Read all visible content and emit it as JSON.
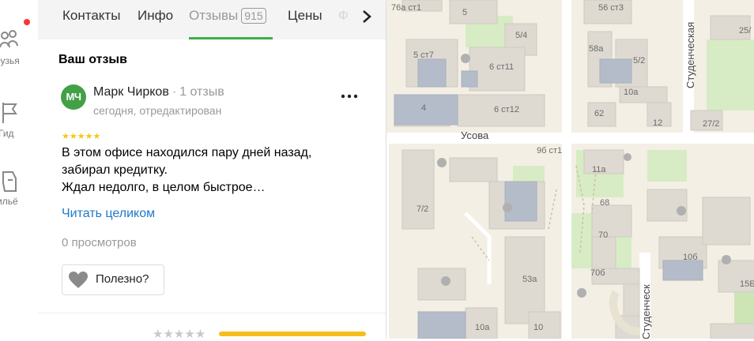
{
  "sidebar": {
    "items": [
      {
        "label": "рузья",
        "icon": "friends-icon"
      },
      {
        "label": "Гид",
        "icon": "flag-icon"
      },
      {
        "label": "ильё",
        "icon": "hand-icon"
      }
    ],
    "notification_color": "#ff3333"
  },
  "tabs": [
    {
      "label": "Контакты"
    },
    {
      "label": "Инфо"
    },
    {
      "label": "Отзывы",
      "badge": "915",
      "active": true
    },
    {
      "label": "Цены"
    },
    {
      "label": "Ф"
    }
  ],
  "review": {
    "section_title": "Ваш отзыв",
    "avatar_initials": "МЧ",
    "author": "Марк Чирков",
    "separator": "·",
    "review_count": "1 отзыв",
    "date": "сегодня, отредактирован",
    "stars": "★★★★★",
    "rating": 5,
    "text_lines": [
      "В этом офисе находился пару дней назад,",
      "забирал кредитку.",
      "Ждал недолго, в целом быстрое…"
    ],
    "read_more": "Читать целиком",
    "views": "0 просмотров",
    "useful_label": "Полезно?"
  },
  "rating_footer": {
    "stars": "★★★★★",
    "bar_fill": 1.0
  },
  "map": {
    "labels": {
      "b1": "76а ст1",
      "b2": "5",
      "b3": "5/4",
      "b4": "5 ст7",
      "b5": "6 ст11",
      "b6": "4",
      "b7": "6 ст12",
      "b8": "56 ст3",
      "b9": "58а",
      "b10": "5/2",
      "b11": "10а",
      "b12": "62",
      "b13": "12",
      "b14": "27/2",
      "b15": "25/",
      "b16": "9б ст1",
      "b17": "7/2",
      "b18": "11а",
      "b19": "68",
      "b20": "70",
      "b21": "10б",
      "b22": "70б",
      "b23": "53а",
      "b24": "10а",
      "b25": "10",
      "b26": "15Б"
    },
    "streets": {
      "usova": "Усова",
      "studencheskaya_top": "Студенческая",
      "studencheskaya_bottom": "Студенческ"
    }
  }
}
